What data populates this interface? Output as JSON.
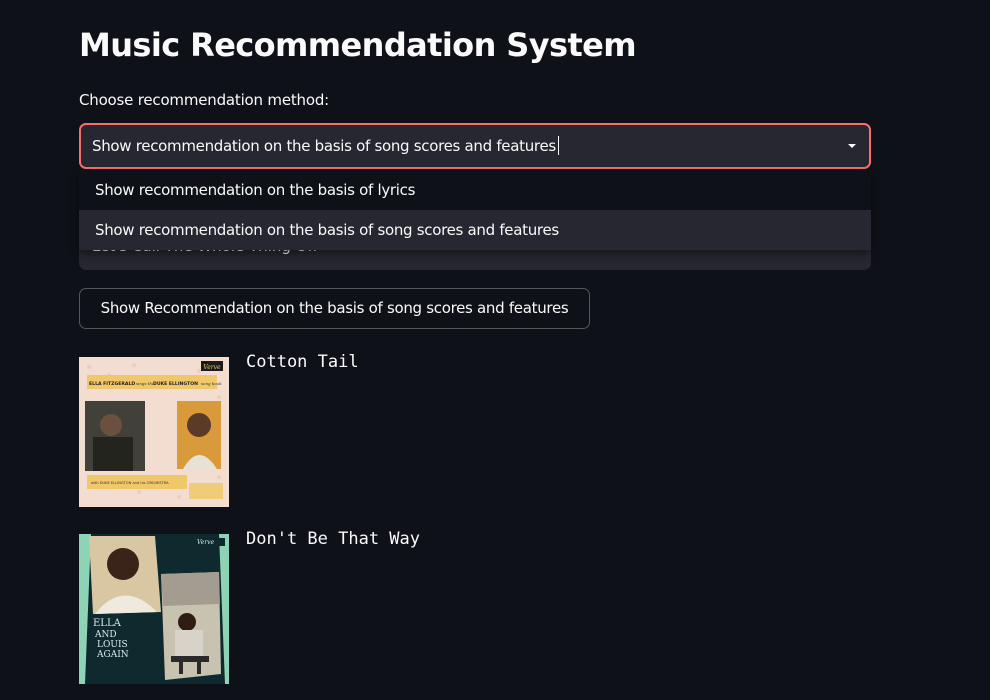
{
  "page": {
    "title": "Music Recommendation System"
  },
  "method_select": {
    "label": "Choose recommendation method:",
    "selected_value": "Show recommendation on the basis of song scores and features",
    "options": [
      "Show recommendation on the basis of lyrics",
      "Show recommendation on the basis of song scores and features"
    ]
  },
  "song_select": {
    "selected_value": "Let's Call The Whole Thing Off"
  },
  "action_button": {
    "label": "Show Recommendation on the basis of song scores and features"
  },
  "recommendations": [
    {
      "title": "Cotton Tail",
      "cover_text": {
        "top_line_left": "ELLA FITZGERALD",
        "top_line_mid": "sings the",
        "top_line_right": "DUKE ELLINGTON",
        "top_line_tail": "song book",
        "bottom_line": "with DUKE ELLINGTON and his ORCHESTRA",
        "logo": "Verve"
      }
    },
    {
      "title": "Don't Be That Way",
      "cover_text": {
        "line1": "ELLA",
        "line2": "AND",
        "line3": "LOUIS",
        "line4": "AGAIN",
        "logo": "Verve"
      }
    }
  ],
  "colors": {
    "background": "#0e1117",
    "widget_background": "#262730",
    "focus_border": "#ff6c6c",
    "text": "#fafafa"
  }
}
